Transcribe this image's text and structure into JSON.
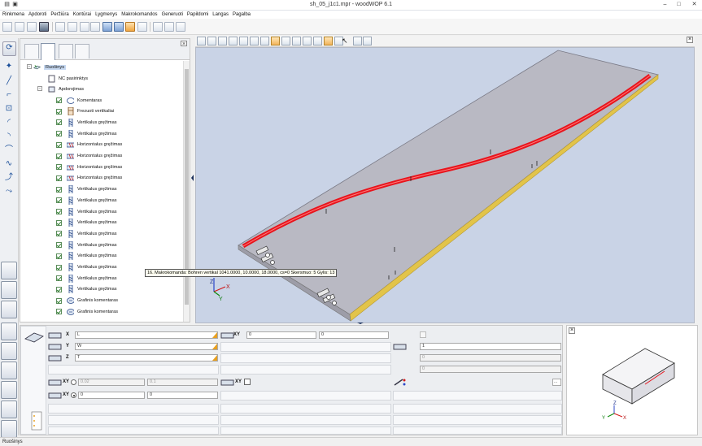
{
  "window": {
    "title": "sh_05_j1c1.mpr - woodWOP 6.1",
    "minimize": "–",
    "maximize": "□",
    "close": "✕"
  },
  "menu": [
    "Rinkmena",
    "Apdoroti",
    "Peržiūra",
    "Kontūrai",
    "Lygmenys",
    "Makrokomandos",
    "Generuoti",
    "Papildomi",
    "Langas",
    "Pagalba"
  ],
  "tree": {
    "root": "Ruošinys",
    "nc": "NC pasirinktys",
    "processing": "Apdorojimas",
    "items": [
      "Komentaras",
      "Frezuoti vertikaliai",
      "Vertikalus gręžimas",
      "Vertikalus gręžimas",
      "Horizontalus gręžimas",
      "Horizontalus gręžimas",
      "Horizontalus gręžimas",
      "Horizontalus gręžimas",
      "Vertikalus gręžimas",
      "Vertikalus gręžimas",
      "Vertikalus gręžimas",
      "Vertikalus gręžimas",
      "Vertikalus gręžimas",
      "Vertikalus gręžimas",
      "Vertikalus gręžimas",
      "Vertikalus gręžimas",
      "Vertikalus gręžimas",
      "Vertikalus gręžimas",
      "Grafinis komentaras",
      "Grafinis komentaras"
    ]
  },
  "tooltip": "16. Makrokomandа: Bohren vertikal 1041.0000, 10.0000, 18.0000, cs=0 Skersmuo: 5 Gylis: 13",
  "axes": {
    "x": "X",
    "y": "Y",
    "z": "Z"
  },
  "props": {
    "x_label": "X",
    "x_value": "L",
    "y_label": "Y",
    "y_value": "W",
    "z_label": "Z",
    "z_value": "T",
    "xy_label": "XY",
    "xy_a": "0",
    "xy_b": "0",
    "xy2_label": "XY",
    "xy2_a": "0",
    "xy2_b": "0",
    "xy3_label": "XY",
    "xy3_a": "0.02",
    "xy3_b": "0.1",
    "xy4_label": "XY",
    "count_value": "1",
    "r1": "0",
    "r2": "0",
    "r3": "0",
    "r4": "0",
    "ellipsis": "..."
  },
  "statusbar": {
    "text": "Ruošinys"
  },
  "colors": {
    "viewport": "#c9d3e6",
    "panel": "#b8bac4",
    "milling": "#e8141c",
    "edge": "#e2c44a"
  }
}
